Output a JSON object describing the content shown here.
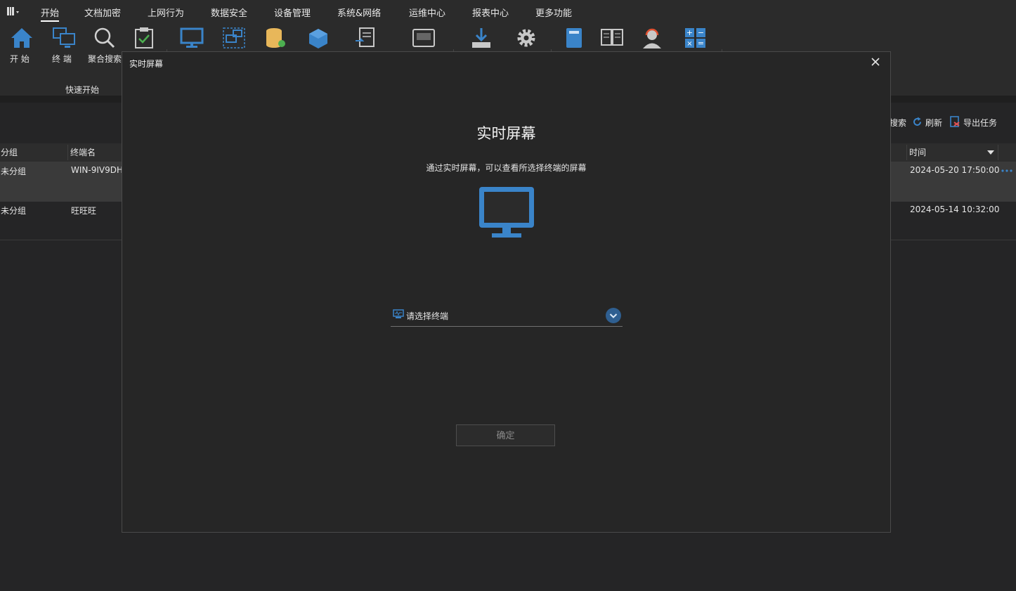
{
  "menu": {
    "items": [
      "开始",
      "文档加密",
      "上网行为",
      "数据安全",
      "设备管理",
      "系统&网络",
      "运维中心",
      "报表中心",
      "更多功能"
    ],
    "active": "开始"
  },
  "toolbar": {
    "home_label": "开 始",
    "terminal_label": "终 端",
    "search_label": "聚合搜索",
    "group_label": "快速开始"
  },
  "actions": {
    "search_partial": "搜索",
    "refresh": "刷新",
    "export": "导出任务"
  },
  "table": {
    "headers": {
      "group": "分组",
      "terminal": "终端名",
      "time": "时间"
    },
    "rows": [
      {
        "group": "未分组",
        "terminal": "WIN-9IV9DH",
        "time": "2024-05-20 17:50:00"
      },
      {
        "group": "未分组",
        "terminal": "旺旺旺",
        "time": "2024-05-14 10:32:00"
      }
    ]
  },
  "dialog": {
    "title": "实时屏幕",
    "heading": "实时屏幕",
    "description": "通过实时屏幕，可以查看所选择终端的屏幕",
    "select_placeholder": "请选择终端",
    "ok_label": "确定"
  },
  "colors": {
    "accent": "#3a84c9",
    "background": "#252526"
  }
}
